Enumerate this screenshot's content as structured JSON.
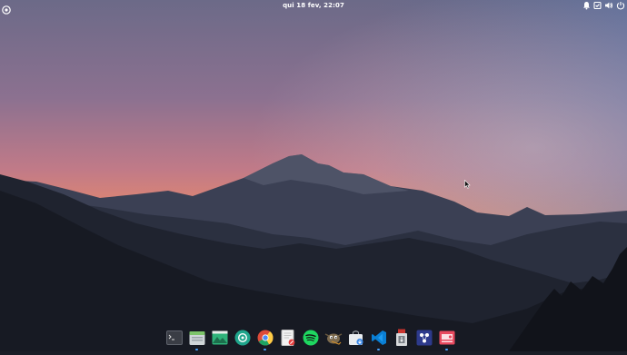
{
  "topbar": {
    "clock": "qui 18 fev, 22:07",
    "left_icon": "apps-menu-icon",
    "right_icons": [
      "notification-bell-icon",
      "checkbox-icon",
      "volume-icon",
      "power-icon"
    ]
  },
  "dock": {
    "items": [
      {
        "name": "terminal",
        "icon": "terminal-icon",
        "running": false
      },
      {
        "name": "files",
        "icon": "files-icon",
        "running": true
      },
      {
        "name": "image-viewer",
        "icon": "image-viewer-icon",
        "running": false
      },
      {
        "name": "screenshot",
        "icon": "screenshot-icon",
        "running": false
      },
      {
        "name": "chrome",
        "icon": "chrome-icon",
        "running": true
      },
      {
        "name": "text-editor",
        "icon": "text-editor-icon",
        "running": false
      },
      {
        "name": "spotify",
        "icon": "spotify-icon",
        "running": false
      },
      {
        "name": "gimp",
        "icon": "gimp-icon",
        "running": false
      },
      {
        "name": "software-store",
        "icon": "software-store-icon",
        "running": false
      },
      {
        "name": "vscode",
        "icon": "vscode-icon",
        "running": true
      },
      {
        "name": "usb-creator",
        "icon": "usb-creator-icon",
        "running": false
      },
      {
        "name": "remote-desktop",
        "icon": "remote-desktop-icon",
        "running": false
      },
      {
        "name": "screen-recorder",
        "icon": "screen-recorder-icon",
        "running": true
      }
    ]
  },
  "colors": {
    "accent_running": "#4aa3ff",
    "sky_top": "#6e6a86",
    "sky_horizon": "#e8886a"
  }
}
